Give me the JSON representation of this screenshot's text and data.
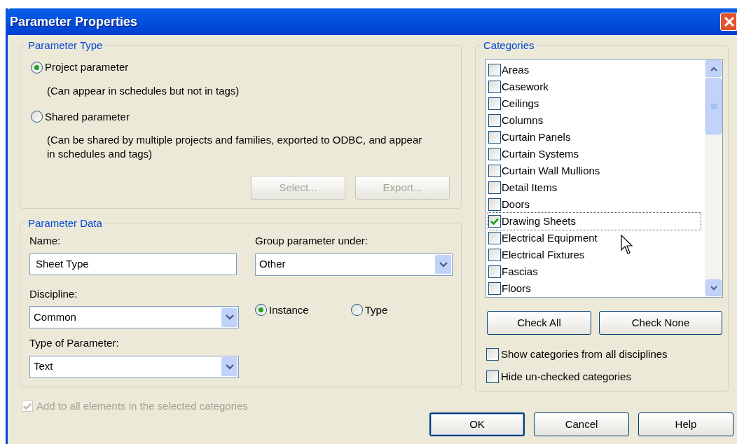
{
  "window": {
    "title": "Parameter Properties"
  },
  "parameter_type": {
    "title": "Parameter Type",
    "options": [
      {
        "label": "Project parameter",
        "description": "(Can appear in schedules but not in tags)",
        "selected": true
      },
      {
        "label": "Shared parameter",
        "description": "(Can be shared by multiple projects and families, exported to ODBC, and appear in schedules and tags)",
        "selected": false
      }
    ],
    "buttons": [
      {
        "label": "Select...",
        "disabled": true
      },
      {
        "label": "Export...",
        "disabled": true
      }
    ]
  },
  "parameter_data": {
    "title": "Parameter Data",
    "name_label": "Name:",
    "name_value": "Sheet Type",
    "group_label": "Group parameter under:",
    "group_value": "Other",
    "discipline_label": "Discipline:",
    "discipline_value": "Common",
    "instance_options": [
      {
        "label": "Instance",
        "selected": true
      },
      {
        "label": "Type",
        "selected": false
      }
    ],
    "type_label": "Type of Parameter:",
    "type_value": "Text"
  },
  "add_to_all": {
    "label": "Add to all elements in the selected categories",
    "checked": true,
    "disabled": true
  },
  "categories": {
    "title": "Categories",
    "items": [
      {
        "label": "Areas",
        "checked": false,
        "focused": false
      },
      {
        "label": "Casework",
        "checked": false,
        "focused": false
      },
      {
        "label": "Ceilings",
        "checked": false,
        "focused": false
      },
      {
        "label": "Columns",
        "checked": false,
        "focused": false
      },
      {
        "label": "Curtain Panels",
        "checked": false,
        "focused": false
      },
      {
        "label": "Curtain Systems",
        "checked": false,
        "focused": false
      },
      {
        "label": "Curtain Wall Mullions",
        "checked": false,
        "focused": false
      },
      {
        "label": "Detail Items",
        "checked": false,
        "focused": false
      },
      {
        "label": "Doors",
        "checked": false,
        "focused": false
      },
      {
        "label": "Drawing Sheets",
        "checked": true,
        "focused": true
      },
      {
        "label": "Electrical Equipment",
        "checked": false,
        "focused": false
      },
      {
        "label": "Electrical Fixtures",
        "checked": false,
        "focused": false
      },
      {
        "label": "Fascias",
        "checked": false,
        "focused": false
      },
      {
        "label": "Floors",
        "checked": false,
        "focused": false
      }
    ],
    "buttons": [
      {
        "label": "Check All"
      },
      {
        "label": "Check None"
      }
    ],
    "options": [
      {
        "label": "Show categories from all disciplines",
        "checked": false
      },
      {
        "label": "Hide un-checked categories",
        "checked": false
      }
    ]
  },
  "footer_buttons": [
    {
      "label": "OK",
      "default": true
    },
    {
      "label": "Cancel",
      "default": false
    },
    {
      "label": "Help",
      "default": false
    }
  ]
}
